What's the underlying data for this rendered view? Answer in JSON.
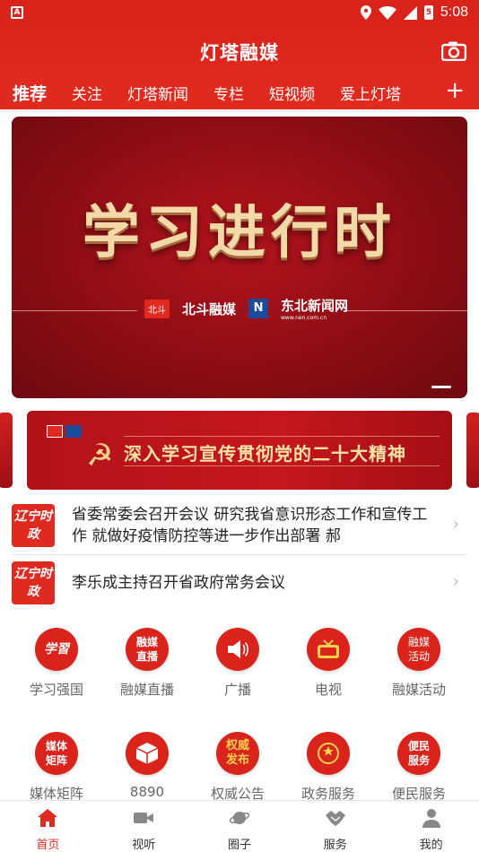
{
  "status_bar": {
    "time": "5:08",
    "battery": "5",
    "app_indicator": "A"
  },
  "header": {
    "title": "灯塔融媒",
    "camera_icon": "camera-icon"
  },
  "tabs": [
    {
      "label": "推荐",
      "active": true
    },
    {
      "label": "关注"
    },
    {
      "label": "灯塔新闻"
    },
    {
      "label": "专栏"
    },
    {
      "label": "短视频"
    },
    {
      "label": "爱上灯塔"
    }
  ],
  "banner": {
    "headline": "学习进行时",
    "logo1_badge": "北斗",
    "logo1_text": "北斗融媒",
    "logo2_mark": "N",
    "logo2_text": "东北新闻网",
    "logo2_url": "www.nen.com.cn"
  },
  "banner2": {
    "slogan": "深入学习宣传贯彻党的二十大精神"
  },
  "news": [
    {
      "badge": "辽宁时政",
      "title": "省委常委会召开会议 研究我省意识形态工作和宣传工作 就做好疫情防控等进一步作出部署 郝"
    },
    {
      "badge": "辽宁时政",
      "title": "李乐成主持召开省政府常务会议"
    }
  ],
  "grid": [
    {
      "label": "学习强国",
      "icon_text": "学習",
      "icon": "xuexi-icon"
    },
    {
      "label": "融媒直播",
      "icon_text": "融媒直播",
      "icon": "live-icon"
    },
    {
      "label": "广播",
      "icon_text": "",
      "icon": "speaker-icon"
    },
    {
      "label": "电视",
      "icon_text": "",
      "icon": "tv-icon"
    },
    {
      "label": "融媒活动",
      "icon_text": "融媒活动",
      "icon": "activity-icon"
    },
    {
      "label": "媒体矩阵",
      "icon_text": "媒体矩阵",
      "icon": "matrix-icon"
    },
    {
      "label": "8890",
      "icon_text": "",
      "icon": "box-icon"
    },
    {
      "label": "权威公告",
      "icon_text": "权威发布",
      "icon": "announce-icon"
    },
    {
      "label": "政务服务",
      "icon_text": "",
      "icon": "emblem-icon"
    },
    {
      "label": "便民服务",
      "icon_text": "便民服务",
      "icon": "service-icon"
    }
  ],
  "bottom_nav": [
    {
      "label": "首页",
      "active": true
    },
    {
      "label": "视听"
    },
    {
      "label": "圈子"
    },
    {
      "label": "服务"
    },
    {
      "label": "我的"
    }
  ],
  "colors": {
    "primary": "#e02a1f",
    "banner_dark": "#8e0d15",
    "gold": "#f3d9a8"
  }
}
